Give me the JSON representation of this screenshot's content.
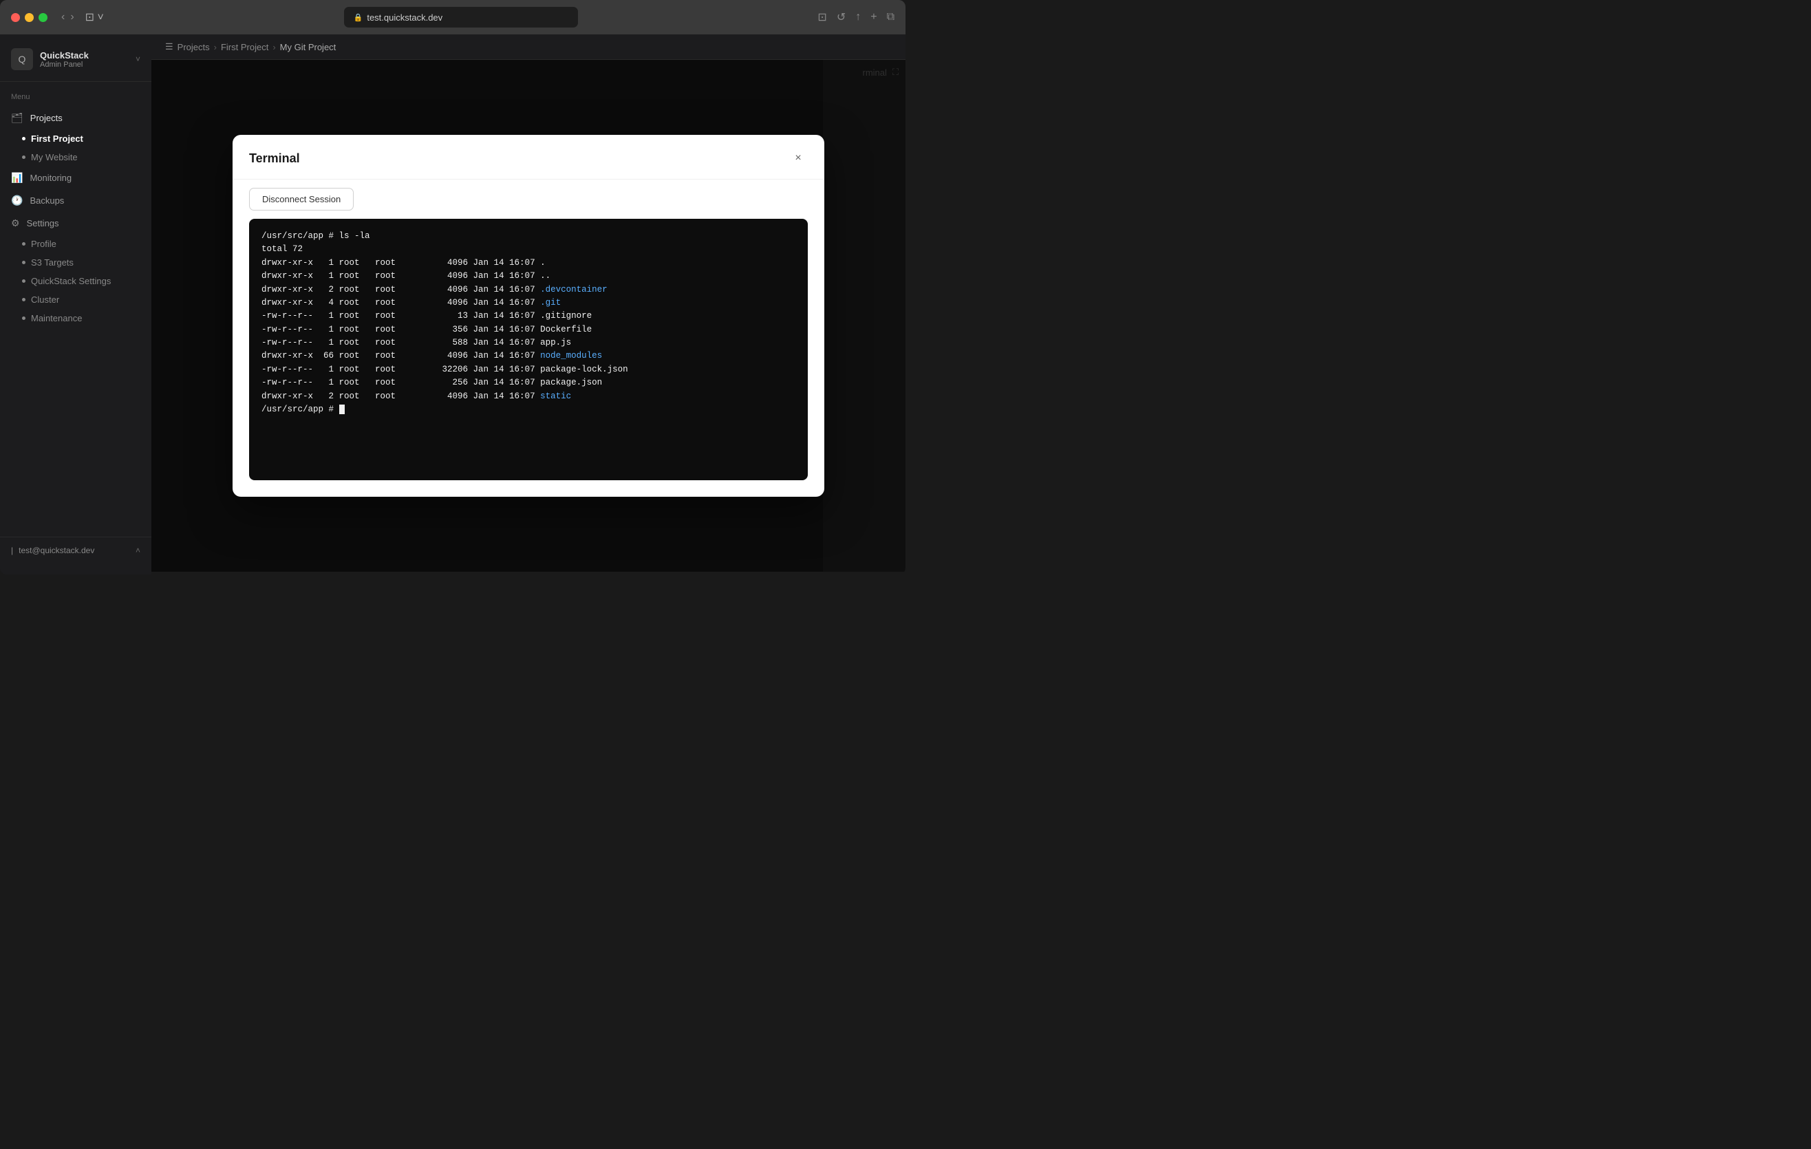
{
  "browser": {
    "url": "test.quickstack.dev",
    "tab_icon": "🔒"
  },
  "app": {
    "name": "QuickStack",
    "subtitle": "Admin Panel"
  },
  "breadcrumb": {
    "items": [
      "Projects",
      "First Project",
      "My Git Project"
    ]
  },
  "sidebar": {
    "logo_icon": "Q",
    "logo_name": "QuickStack",
    "logo_subtitle": "Admin Panel",
    "menu_label": "Menu",
    "items": [
      {
        "id": "projects",
        "label": "Projects",
        "icon": "🗂"
      },
      {
        "id": "first-project",
        "label": "First Project",
        "sub": true,
        "active": true
      },
      {
        "id": "my-website",
        "label": "My Website",
        "sub": true
      },
      {
        "id": "monitoring",
        "label": "Monitoring",
        "icon": "📊"
      },
      {
        "id": "backups",
        "label": "Backups",
        "icon": "🕐"
      },
      {
        "id": "settings",
        "label": "Settings",
        "icon": "⚙"
      },
      {
        "id": "profile",
        "label": "Profile",
        "sub": true
      },
      {
        "id": "s3-targets",
        "label": "S3 Targets",
        "sub": true
      },
      {
        "id": "quickstack-settings",
        "label": "QuickStack Settings",
        "sub": true
      },
      {
        "id": "cluster",
        "label": "Cluster",
        "sub": true
      },
      {
        "id": "maintenance",
        "label": "Maintenance",
        "sub": true
      }
    ],
    "footer_user": "test@quickstack.dev"
  },
  "modal": {
    "title": "Terminal",
    "close_label": "×",
    "disconnect_button": "Disconnect Session",
    "terminal_lines": [
      {
        "type": "prompt",
        "text": "/usr/src/app # ls -la"
      },
      {
        "type": "normal",
        "text": "total 72"
      },
      {
        "type": "normal",
        "text": "drwxr-xr-x   1 root   root          4096 Jan 14 16:07 ."
      },
      {
        "type": "normal",
        "text": "drwxr-xr-x   1 root   root          4096 Jan 14 16:07 .."
      },
      {
        "type": "blue",
        "text": "drwxr-xr-x   2 root   root          4096 Jan 14 16:07 .devcontainer"
      },
      {
        "type": "blue",
        "text": "drwxr-xr-x   4 root   root          4096 Jan 14 16:07 .git"
      },
      {
        "type": "normal",
        "text": "-rw-r--r--   1 root   root            13 Jan 14 16:07 .gitignore"
      },
      {
        "type": "normal",
        "text": "-rw-r--r--   1 root   root           356 Jan 14 16:07 Dockerfile"
      },
      {
        "type": "normal",
        "text": "-rw-r--r--   1 root   root           588 Jan 14 16:07 app.js"
      },
      {
        "type": "blue",
        "text": "drwxr-xr-x  66 root   root          4096 Jan 14 16:07 node_modules"
      },
      {
        "type": "normal",
        "text": "-rw-r--r--   1 root   root         32206 Jan 14 16:07 package-lock.json"
      },
      {
        "type": "normal",
        "text": "-rw-r--r--   1 root   root           256 Jan 14 16:07 package.json"
      },
      {
        "type": "blue",
        "text": "drwxr-xr-x   2 root   root          4096 Jan 14 16:07 static"
      },
      {
        "type": "prompt_cursor",
        "text": "/usr/src/app # "
      }
    ]
  },
  "right_panel": {
    "terminal_label": "rminal",
    "expand_icon": "⛶"
  }
}
